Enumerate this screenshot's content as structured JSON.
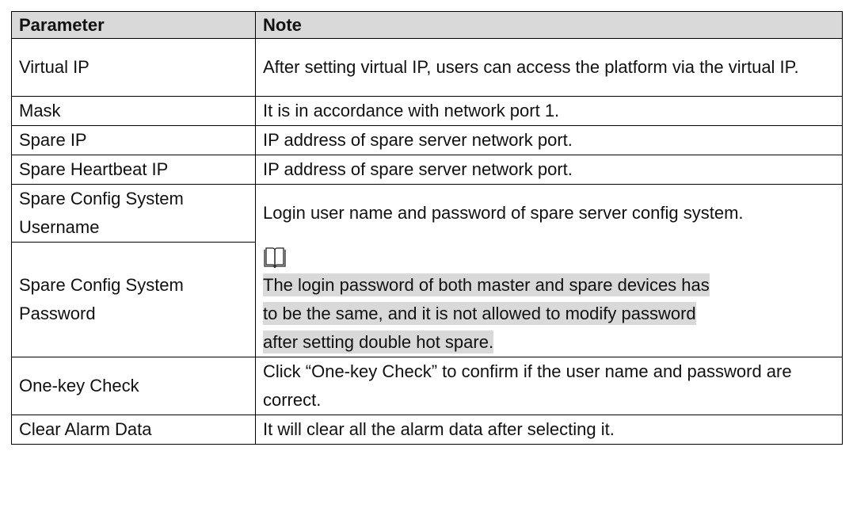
{
  "table": {
    "headers": {
      "parameter": "Parameter",
      "note": "Note"
    },
    "rows": [
      {
        "parameter": "Virtual IP",
        "note": "After setting virtual IP, users can access the platform via the virtual IP."
      },
      {
        "parameter": "Mask",
        "note": "It is in accordance with network port 1."
      },
      {
        "parameter": "Spare IP",
        "note": "IP address of spare server network port."
      },
      {
        "parameter": "Spare Heartbeat IP",
        "note": "IP address of spare server network port."
      },
      {
        "parameter": "Spare Config System Username",
        "note": "Login user name and password of spare server config system."
      },
      {
        "parameter": "Spare Config System Password",
        "note_icon": "book-icon",
        "note_lines": [
          "The login password of both master and spare devices has",
          "to be the same, and it is not allowed to modify password",
          "after setting double hot spare."
        ]
      },
      {
        "parameter": "One-key Check",
        "note": "Click “One-key Check” to confirm if the user name and password are correct."
      },
      {
        "parameter": "Clear Alarm Data",
        "note": "It will clear all the alarm data after selecting it."
      }
    ]
  },
  "colors": {
    "header_bg": "#d9d9d9",
    "highlight_bg": "#d9d9d9",
    "border": "#000000"
  }
}
